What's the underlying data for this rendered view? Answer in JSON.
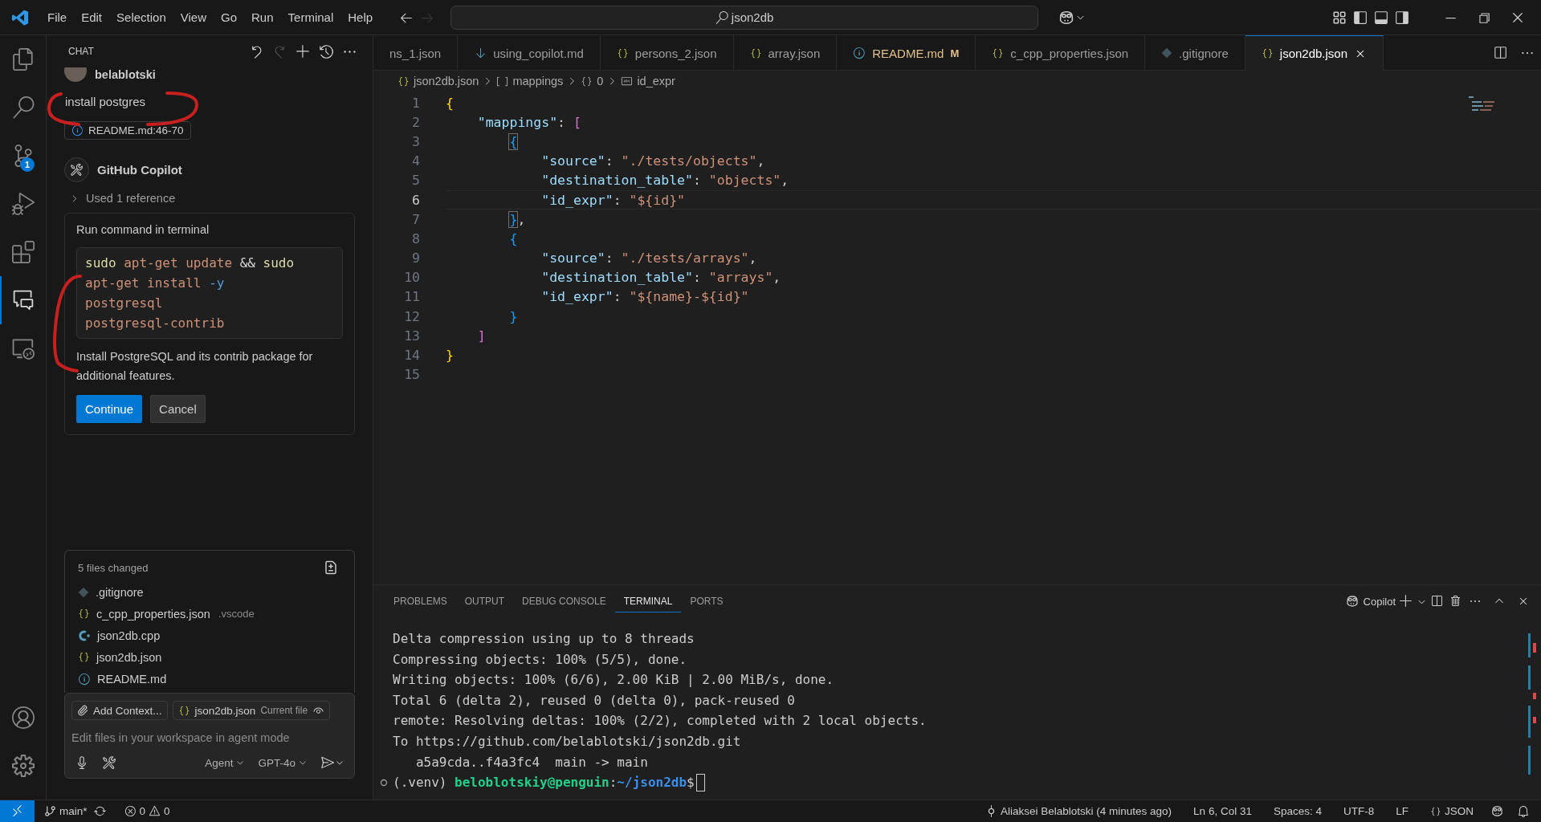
{
  "title_bar": {
    "menu": [
      "File",
      "Edit",
      "Selection",
      "View",
      "Go",
      "Run",
      "Terminal",
      "Help"
    ],
    "search": "json2db"
  },
  "activity_bar": {
    "items": [
      {
        "kind": "explorer",
        "selected": false
      },
      {
        "kind": "search",
        "selected": false
      },
      {
        "kind": "source-control",
        "selected": false,
        "badge": "1"
      },
      {
        "kind": "debug",
        "selected": false
      },
      {
        "kind": "extensions",
        "selected": false
      },
      {
        "kind": "chat",
        "selected": true
      },
      {
        "kind": "remote",
        "selected": false
      }
    ]
  },
  "chat": {
    "title": "CHAT",
    "actions": [
      {
        "kind": "undo",
        "disabled": false
      },
      {
        "kind": "redo",
        "disabled": true
      },
      {
        "kind": "new",
        "disabled": false
      },
      {
        "kind": "history",
        "disabled": false
      },
      {
        "kind": "more",
        "disabled": false
      }
    ],
    "user": "belablotski",
    "message": "install postgres",
    "reference": "README.md:46-70",
    "assistant": "GitHub Copilot",
    "used_references": "Used 1 reference",
    "tool_card": {
      "title": "Run command in terminal",
      "command_lines": [
        [
          {
            "text": "sudo",
            "kind": "cmd"
          },
          {
            "text": "apt-get",
            "kind": "arg"
          },
          {
            "text": "update",
            "kind": "arg"
          },
          {
            "text": "&&",
            "kind": "op"
          },
          {
            "text": "sudo",
            "kind": "cmd"
          }
        ],
        [
          {
            "text": "apt-get",
            "kind": "arg"
          },
          {
            "text": "install",
            "kind": "arg"
          },
          {
            "text": "-y",
            "kind": "flag"
          }
        ],
        [
          {
            "text": "postgresql",
            "kind": "arg"
          }
        ],
        [
          {
            "text": "postgresql-contrib",
            "kind": "arg"
          }
        ]
      ],
      "description": "Install PostgreSQL and its contrib package for additional features.",
      "buttons": [
        {
          "label": "Continue",
          "primary": true
        },
        {
          "label": "Cancel",
          "primary": false
        }
      ]
    },
    "changes": {
      "title": "5 files changed",
      "files": [
        {
          "name": ".gitignore",
          "kind": "git"
        },
        {
          "name": "c_cpp_properties.json",
          "kind": "json",
          "folder": ".vscode"
        },
        {
          "name": "json2db.cpp",
          "kind": "cpp"
        },
        {
          "name": "json2db.json",
          "kind": "json"
        },
        {
          "name": "README.md",
          "kind": "info"
        }
      ]
    },
    "input": {
      "attachments": [
        {
          "label": "Add Context...",
          "kind": "add"
        },
        {
          "label": "json2db.json",
          "kind": "file",
          "note": "Current file"
        }
      ],
      "placeholder": "Edit files in your workspace in agent mode",
      "mode": "Agent",
      "model": "GPT-4o"
    }
  },
  "editor": {
    "tabs": [
      {
        "label": "ns_1.json",
        "selected": false
      },
      {
        "label": "using_copilot.md",
        "kind": "md",
        "selected": false
      },
      {
        "label": "persons_2.json",
        "kind": "json",
        "selected": false
      },
      {
        "label": "array.json",
        "kind": "json",
        "selected": false
      },
      {
        "label": "README.md",
        "kind": "info",
        "selected": false,
        "decoration": "M"
      },
      {
        "label": "c_cpp_properties.json",
        "kind": "json",
        "selected": false
      },
      {
        "label": ".gitignore",
        "kind": "git",
        "selected": false
      },
      {
        "label": "json2db.json",
        "kind": "json",
        "selected": true
      }
    ],
    "breadcrumb": [
      {
        "label": "json2db.json",
        "kind": "json"
      },
      {
        "label": "mappings",
        "kind": "array"
      },
      {
        "label": "0",
        "kind": "object"
      },
      {
        "label": "id_expr",
        "kind": "string"
      }
    ],
    "lines": [
      {
        "number": "1",
        "current": false,
        "tokens": [
          {
            "text": "{",
            "kind": "bracket1"
          }
        ]
      },
      {
        "number": "2",
        "current": false,
        "tokens": [
          {
            "text": "    \"mappings\"",
            "kind": "key"
          },
          {
            "text": ": ",
            "kind": "punct"
          },
          {
            "text": "[",
            "kind": "bracket2"
          }
        ]
      },
      {
        "number": "3",
        "current": false,
        "tokens": [
          {
            "text": "        {",
            "kind": "bracket3",
            "matched": true
          }
        ]
      },
      {
        "number": "4",
        "current": false,
        "tokens": [
          {
            "text": "            \"source\"",
            "kind": "key"
          },
          {
            "text": ": ",
            "kind": "punct"
          },
          {
            "text": "\"./tests/objects\"",
            "kind": "string"
          },
          {
            "text": ",",
            "kind": "punct"
          }
        ]
      },
      {
        "number": "5",
        "current": false,
        "tokens": [
          {
            "text": "            \"destination_table\"",
            "kind": "key"
          },
          {
            "text": ": ",
            "kind": "punct"
          },
          {
            "text": "\"objects\"",
            "kind": "string"
          },
          {
            "text": ",",
            "kind": "punct"
          }
        ]
      },
      {
        "number": "6",
        "current": true,
        "tokens": [
          {
            "text": "            \"id_expr\"",
            "kind": "key"
          },
          {
            "text": ": ",
            "kind": "punct"
          },
          {
            "text": "\"${id}\"",
            "kind": "string"
          }
        ]
      },
      {
        "number": "7",
        "current": false,
        "tokens": [
          {
            "text": "        }",
            "kind": "bracket3",
            "matched": true
          },
          {
            "text": ",",
            "kind": "punct"
          }
        ]
      },
      {
        "number": "8",
        "current": false,
        "tokens": [
          {
            "text": "        {",
            "kind": "bracket3"
          }
        ]
      },
      {
        "number": "9",
        "current": false,
        "tokens": [
          {
            "text": "            \"source\"",
            "kind": "key"
          },
          {
            "text": ": ",
            "kind": "punct"
          },
          {
            "text": "\"./tests/arrays\"",
            "kind": "string"
          },
          {
            "text": ",",
            "kind": "punct"
          }
        ]
      },
      {
        "number": "10",
        "current": false,
        "tokens": [
          {
            "text": "            \"destination_table\"",
            "kind": "key"
          },
          {
            "text": ": ",
            "kind": "punct"
          },
          {
            "text": "\"arrays\"",
            "kind": "string"
          },
          {
            "text": ",",
            "kind": "punct"
          }
        ]
      },
      {
        "number": "11",
        "current": false,
        "tokens": [
          {
            "text": "            \"id_expr\"",
            "kind": "key"
          },
          {
            "text": ": ",
            "kind": "punct"
          },
          {
            "text": "\"${name}-${id}\"",
            "kind": "string"
          }
        ]
      },
      {
        "number": "12",
        "current": false,
        "tokens": [
          {
            "text": "        }",
            "kind": "bracket3"
          }
        ]
      },
      {
        "number": "13",
        "current": false,
        "tokens": [
          {
            "text": "    ]",
            "kind": "bracket2"
          }
        ]
      },
      {
        "number": "14",
        "current": false,
        "tokens": [
          {
            "text": "}",
            "kind": "bracket1"
          }
        ]
      },
      {
        "number": "15",
        "current": false
      }
    ]
  },
  "panel": {
    "tabs": [
      {
        "label": "PROBLEMS",
        "selected": false
      },
      {
        "label": "OUTPUT",
        "selected": false
      },
      {
        "label": "DEBUG CONSOLE",
        "selected": false
      },
      {
        "label": "TERMINAL",
        "selected": true
      },
      {
        "label": "PORTS",
        "selected": false
      }
    ],
    "terminal_name": "Copilot",
    "lines": [
      "Delta compression using up to 8 threads",
      "Compressing objects: 100% (5/5), done.",
      "Writing objects: 100% (6/6), 2.00 KiB | 2.00 MiB/s, done.",
      "Total 6 (delta 2), reused 0 (delta 0), pack-reused 0",
      "remote: Resolving deltas: 100% (2/2), completed with 2 local objects.",
      "To https://github.com/belablotski/json2db.git",
      "   a5a9cda..f4a3fc4  main -> main"
    ],
    "prompt": [
      {
        "text": "(.venv) ",
        "kind": "plain"
      },
      {
        "text": "beloblotskiy@penguin",
        "kind": "user"
      },
      {
        "text": ":",
        "kind": "plain"
      },
      {
        "text": "~/json2db",
        "kind": "path"
      },
      {
        "text": "$",
        "kind": "plain"
      }
    ]
  },
  "status_bar": {
    "branch": "main*",
    "errors": "0",
    "warnings": "0",
    "blame": "Aliaksei Belablotski (4 minutes ago)",
    "position": "Ln 6, Col 31",
    "indentation": "Spaces: 4",
    "encoding": "UTF-8",
    "eol": "LF",
    "language": "JSON"
  }
}
